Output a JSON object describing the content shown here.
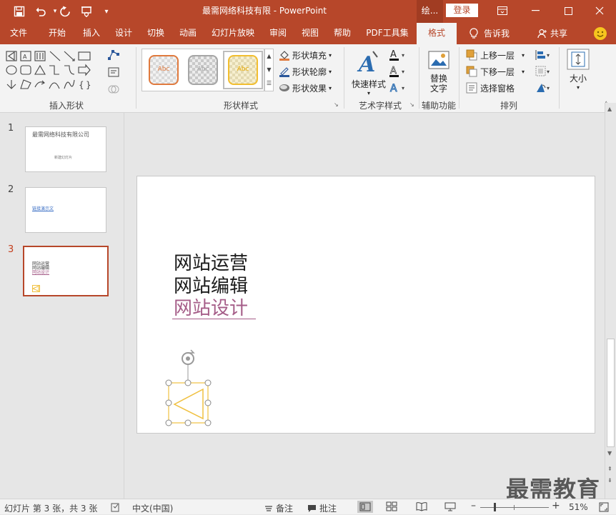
{
  "titlebar": {
    "title": "最需网络科技有限  -  PowerPoint",
    "context_tab": "绘...",
    "login": "登录"
  },
  "tabs": [
    "文件",
    "开始",
    "插入",
    "设计",
    "切换",
    "动画",
    "幻灯片放映",
    "审阅",
    "视图",
    "帮助",
    "PDF工具集",
    "格式"
  ],
  "active_tab": "格式",
  "tell_me": "告诉我",
  "share": "共享",
  "ribbon": {
    "groups": {
      "insert_shapes": "插入形状",
      "shape_styles": "形状样式",
      "wordart_styles": "艺术字样式",
      "accessibility": "辅助功能",
      "arrange": "排列"
    },
    "style_thumb_text": "Abc",
    "shape_fill": "形状填充",
    "shape_outline": "形状轮廓",
    "shape_effects": "形状效果",
    "quick_styles": "快速样式",
    "alt_text_1": "替换",
    "alt_text_2": "文字",
    "bring_forward": "上移一层",
    "send_backward": "下移一层",
    "selection_pane": "选择窗格",
    "size": "大小",
    "accent": "#b7472a"
  },
  "slides": [
    {
      "num": "1",
      "title": "最需网络科技有限公司",
      "subtitle": "新建幻灯片"
    },
    {
      "num": "2",
      "link": "链接演示文"
    },
    {
      "num": "3",
      "lines": [
        "网站运营",
        "网站编辑",
        "网站设计"
      ]
    }
  ],
  "slide_content": {
    "line1": "网站运营",
    "line2": "网站编辑",
    "line3": "网站设计",
    "link_color": "#a55d88"
  },
  "statusbar": {
    "slide_info": "幻灯片 第 3 张，共 3 张",
    "language": "中文(中国)",
    "notes": "备注",
    "comments": "批注",
    "zoom": "51%"
  },
  "watermark": "最需教育"
}
